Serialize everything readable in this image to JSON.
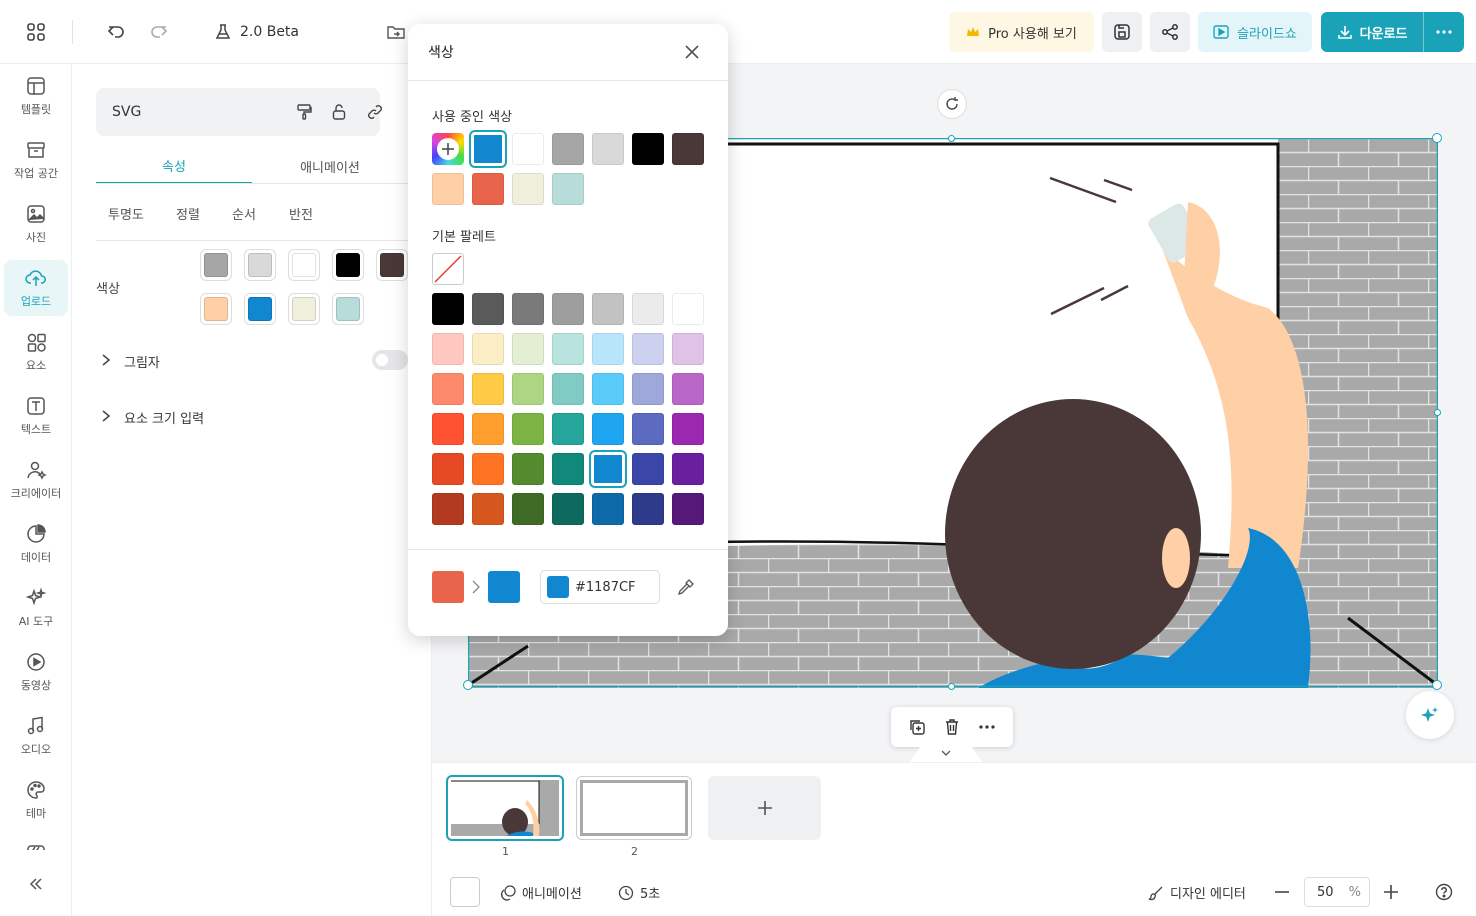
{
  "topbar": {
    "version_label": "2.0 Beta",
    "pro_label": "Pro 사용해 보기",
    "slideshow_label": "슬라이드쇼",
    "download_label": "다운로드"
  },
  "rail": {
    "items": [
      {
        "label": "템플릿",
        "icon": "template-icon"
      },
      {
        "label": "작업 공간",
        "icon": "workspace-icon"
      },
      {
        "label": "사진",
        "icon": "photo-icon"
      },
      {
        "label": "업로드",
        "icon": "upload-icon",
        "active": true
      },
      {
        "label": "요소",
        "icon": "elements-icon"
      },
      {
        "label": "텍스트",
        "icon": "text-icon"
      },
      {
        "label": "크리에이터",
        "icon": "creator-icon"
      },
      {
        "label": "데이터",
        "icon": "data-icon"
      },
      {
        "label": "AI 도구",
        "icon": "ai-tools-icon"
      },
      {
        "label": "동영상",
        "icon": "video-icon"
      },
      {
        "label": "오디오",
        "icon": "audio-icon"
      },
      {
        "label": "테마",
        "icon": "theme-icon"
      }
    ]
  },
  "panel": {
    "element_type": "SVG",
    "tabs": [
      "속성",
      "애니메이션"
    ],
    "subtabs": [
      "투명도",
      "정렬",
      "순서",
      "반전"
    ],
    "color_label": "색상",
    "colors_row1": [
      "#A6A6A6",
      "#D9D9D9",
      "#FFFFFF",
      "#000000",
      "#4A3838"
    ],
    "colors_row2": [
      "#FFD0A6",
      "#1187CF",
      "#F0EFDC",
      "#B8DCDA"
    ],
    "shadow_label": "그림자",
    "size_label": "요소 크기 입력"
  },
  "popup": {
    "title": "색상",
    "used_title": "사용 중인 색상",
    "used_colors": [
      "#1187CF",
      "#FFFFFF",
      "#A6A6A6",
      "#D9D9D9",
      "#000000",
      "#4A3838",
      "#FFD0A6",
      "#E8644A",
      "#F0EFDC",
      "#B8DCDA"
    ],
    "palette_title": "기본 팔레트",
    "palette": [
      [
        "#000000",
        "#5A5A5A",
        "#7A7A7A",
        "#9E9E9E",
        "#C2C2C2",
        "#EBEBEB",
        "#FFFFFF"
      ],
      [
        "#FFC8BF",
        "#FCEEC4",
        "#E4EED3",
        "#B8E3DE",
        "#B9E5FB",
        "#CDD1F0",
        "#E0C2E8"
      ],
      [
        "#FF8A6B",
        "#FFCA45",
        "#AED581",
        "#80CBC4",
        "#5BCCFA",
        "#9FA8DA",
        "#BA68C8"
      ],
      [
        "#FF5230",
        "#FFA02E",
        "#7CB342",
        "#26A69A",
        "#1EA7F0",
        "#5C6BC0",
        "#9C27B0"
      ],
      [
        "#E64A25",
        "#FF7424",
        "#558B2F",
        "#10897A",
        "#1187CF",
        "#3A47A8",
        "#6A1FA0"
      ],
      [
        "#B23A20",
        "#D6571E",
        "#3F6B27",
        "#0E6A5F",
        "#0E6AA8",
        "#2E3A8A",
        "#55197A"
      ]
    ],
    "from_color": "#E8644A",
    "to_color": "#1187CF",
    "hex_value": "#1187CF"
  },
  "bottom": {
    "pages": [
      "1",
      "2"
    ],
    "animation_label": "애니메이션",
    "duration_label": "5초",
    "design_editor_label": "디자인 에디터",
    "zoom_value": "50",
    "zoom_unit": "%"
  }
}
